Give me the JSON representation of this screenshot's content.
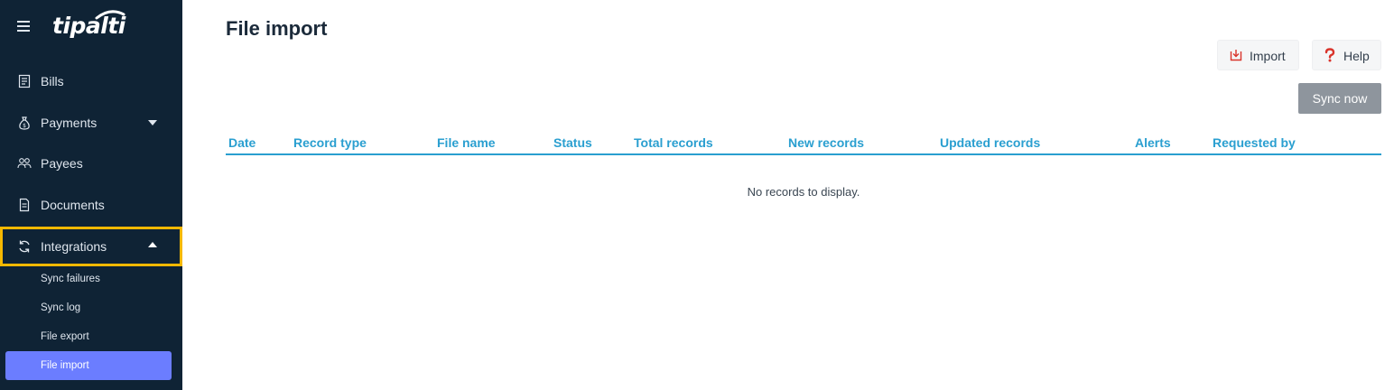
{
  "app": {
    "logo_text": "tipalti"
  },
  "sidebar": {
    "items": [
      {
        "label": "Bills",
        "icon": "receipt-icon"
      },
      {
        "label": "Payments",
        "icon": "money-bag-icon"
      },
      {
        "label": "Payees",
        "icon": "people-icon"
      },
      {
        "label": "Documents",
        "icon": "document-icon"
      },
      {
        "label": "Integrations",
        "icon": "sync-icon"
      }
    ],
    "sub_items": [
      {
        "label": "Sync failures"
      },
      {
        "label": "Sync log"
      },
      {
        "label": "File export"
      },
      {
        "label": "File import"
      }
    ],
    "selected_sub_item": "File import",
    "highlight_color": "#f6b800",
    "selected_color": "#6b7dff"
  },
  "main": {
    "title": "File import",
    "import_label": "Import",
    "help_label": "Help",
    "sync_label": "Sync now",
    "columns": [
      "Date",
      "Record type",
      "File name",
      "Status",
      "Total records",
      "New records",
      "Updated records",
      "Alerts",
      "Requested by"
    ],
    "empty_message": "No records to display.",
    "accent_color": "#2a9fd0"
  }
}
